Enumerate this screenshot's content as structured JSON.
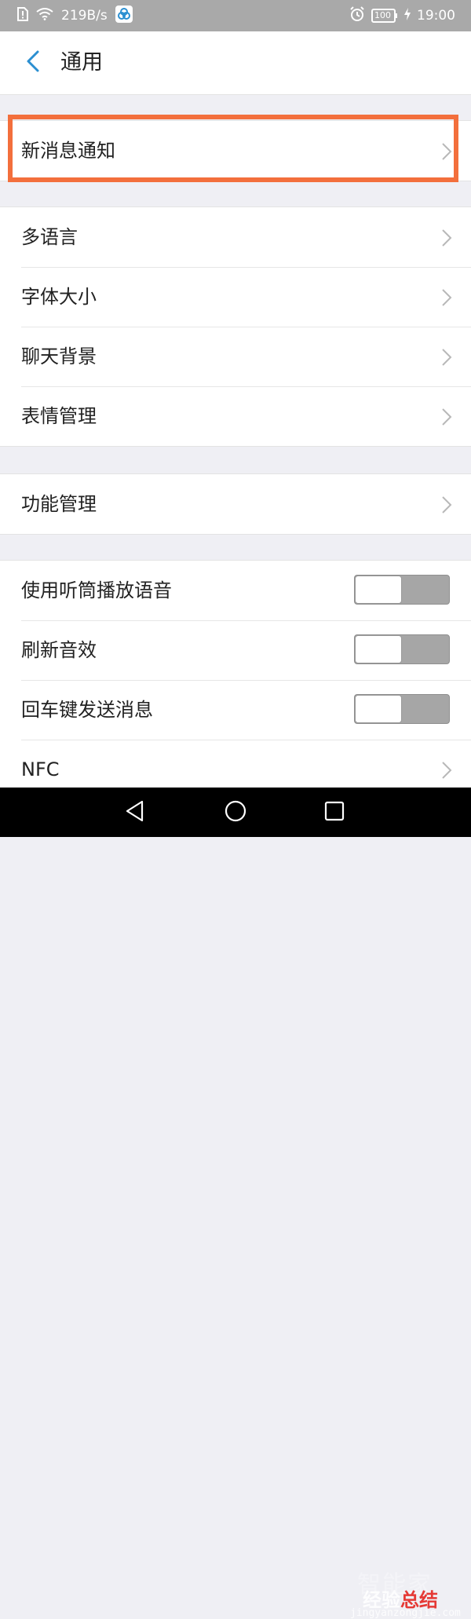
{
  "status_bar": {
    "net_speed": "219B/s",
    "battery": "100",
    "time": "19:00"
  },
  "header": {
    "title": "通用"
  },
  "groups": [
    {
      "items": [
        {
          "label": "新消息通知",
          "control": "chevron"
        }
      ]
    },
    {
      "items": [
        {
          "label": "多语言",
          "control": "chevron"
        },
        {
          "label": "字体大小",
          "control": "chevron"
        },
        {
          "label": "聊天背景",
          "control": "chevron"
        },
        {
          "label": "表情管理",
          "control": "chevron"
        }
      ]
    },
    {
      "items": [
        {
          "label": "功能管理",
          "control": "chevron"
        }
      ]
    },
    {
      "items": [
        {
          "label": "使用听筒播放语音",
          "control": "toggle",
          "on": false
        },
        {
          "label": "刷新音效",
          "control": "toggle",
          "on": false
        },
        {
          "label": "回车键发送消息",
          "control": "toggle",
          "on": false
        },
        {
          "label": "NFC",
          "control": "chevron"
        }
      ]
    }
  ],
  "watermark": {
    "line1": "智能家",
    "line2a": "经验",
    "line2b": "总结",
    "line3": "jingyanzongjie.com"
  },
  "colors": {
    "accent": "#2b8fd1",
    "highlight": "#f36f3c",
    "status_bar": "#a9a9a9",
    "nav_bar": "#000000"
  }
}
